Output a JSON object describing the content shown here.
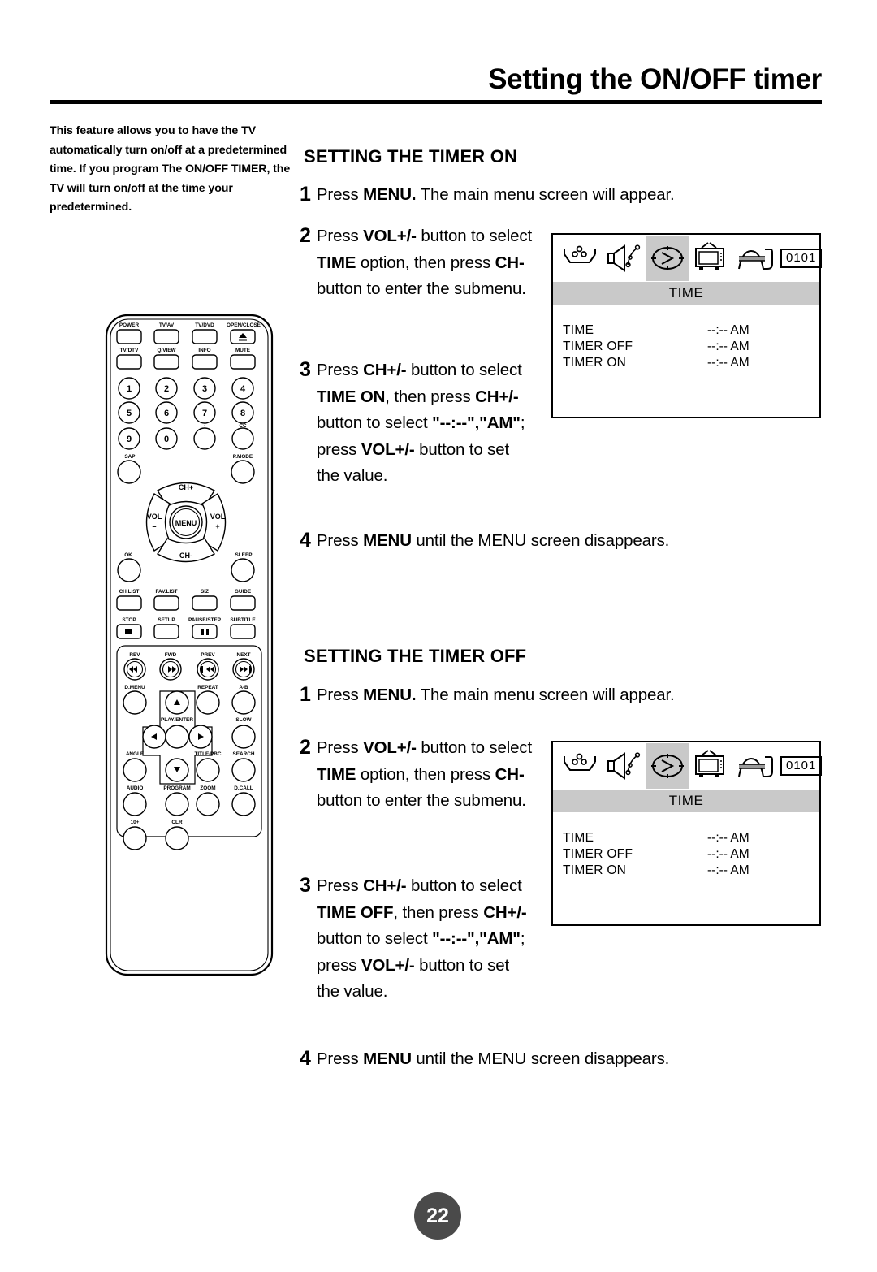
{
  "page": {
    "title": "Setting the ON/OFF timer",
    "number": "22"
  },
  "intro": "This feature allows you to have the TV automatically turn on/off at a predetermined time. If you program The ON/OFF TIMER, the TV will turn on/off at the time your predetermined.",
  "sections": {
    "timer_on": {
      "heading": "SETTING THE TIMER ON",
      "steps": [
        {
          "num": "1",
          "html": "Press <b>MENU.</b> The main menu screen will appear."
        },
        {
          "num": "2",
          "html": "Press <b>VOL+/-</b> button to select <b>TIME</b> option, then press <b>CH-</b> button to enter the submenu."
        },
        {
          "num": "3",
          "html": "Press <b>CH+/-</b> button to select <b>TIME ON</b>, then press <b>CH+/-</b> button to select <b>\"--:--\",\"AM\"</b>; press <b>VOL+/-</b> button to set the value."
        },
        {
          "num": "4",
          "html": "Press <b>MENU</b> until the MENU screen disappears."
        }
      ]
    },
    "timer_off": {
      "heading": "SETTING THE TIMER OFF",
      "steps": [
        {
          "num": "1",
          "html": "Press <b>MENU.</b> The main menu screen will appear."
        },
        {
          "num": "2",
          "html": "Press <b>VOL+/-</b> button to select <b>TIME</b> option, then press <b>CH-</b> button to enter the submenu."
        },
        {
          "num": "3",
          "html": "Press <b>CH+/-</b> button to select <b>TIME OFF</b>, then press <b>CH+/-</b> button to select <b>\"--:--\",\"AM\"</b>; press <b>VOL+/-</b> button to set the value."
        },
        {
          "num": "4",
          "html": "Press <b>MENU</b> until the MENU screen disappears."
        }
      ]
    }
  },
  "osd": {
    "tabs": [
      {
        "icon": "picture-icon",
        "selected": false
      },
      {
        "icon": "speaker-audio-icon",
        "selected": false
      },
      {
        "icon": "clock-timer-icon",
        "selected": true
      },
      {
        "icon": "tv-antenna-icon",
        "selected": false
      },
      {
        "icon": "setup-icon",
        "selected": false
      }
    ],
    "channel": "0101",
    "title": "TIME",
    "rows": [
      {
        "label": "TIME",
        "value": "--:-- AM"
      },
      {
        "label": "TIMER OFF",
        "value": "--:-- AM"
      },
      {
        "label": "TIMER ON",
        "value": "--:-- AM"
      }
    ]
  },
  "remote": {
    "row1": [
      "POWER",
      "TV/AV",
      "TV/DVD",
      "OPEN/CLOSE"
    ],
    "row2": [
      "TV/DTV",
      "Q.VIEW",
      "INFO",
      "MUTE"
    ],
    "numbers": [
      "1",
      "2",
      "3",
      "4",
      "5",
      "6",
      "7",
      "8",
      "9",
      "0"
    ],
    "dash_label": "-",
    "cc_label": "CC",
    "sap_label": "SAP",
    "pmode_label": "P.MODE",
    "nav": {
      "ch_up": "CH+",
      "ch_down": "CH-",
      "vol_down_top": "VOL",
      "vol_down_bottom": "–",
      "vol_up_top": "VOL",
      "vol_up_bottom": "+",
      "menu": "MENU"
    },
    "ok_label": "OK",
    "sleep_label": "SLEEP",
    "row_list": [
      "CH.LIST",
      "FAV.LIST",
      "SIZ",
      "GUIDE"
    ],
    "row_stop": [
      "STOP",
      "SETUP",
      "PAUSE/STEP",
      "SUBTITLE"
    ],
    "row_transport": [
      "REV",
      "FWD",
      "PREV",
      "NEXT"
    ],
    "row_dmenu": [
      "D.MENU",
      "REPEAT",
      "A-B"
    ],
    "playenter_label": "PLAY/ENTER",
    "slow_label": "SLOW",
    "angle_label": "ANGLE",
    "titlepbc_label": "TITLE/PBC",
    "search_label": "SEARCH",
    "row_audio": [
      "AUDIO",
      "PROGRAM",
      "ZOOM",
      "D.CALL"
    ],
    "row_last": [
      "10+",
      "CLR"
    ],
    "power_color": "#e01b1b"
  }
}
